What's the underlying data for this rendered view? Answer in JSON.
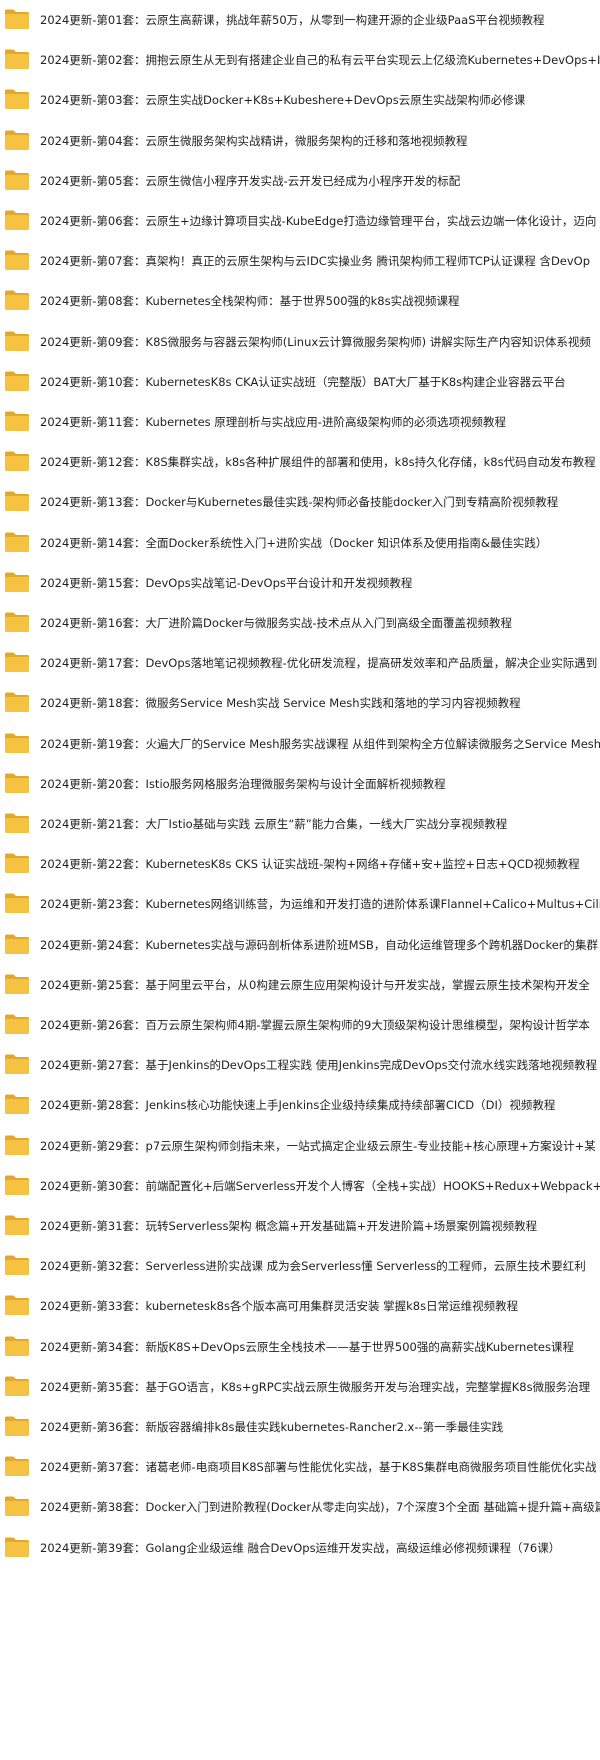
{
  "folder_icon": "folder-icon",
  "folder_color": "#f5c242",
  "folder_color_dark": "#e0a82e",
  "items": [
    {
      "label": "2024更新-第01套：云原生高薪课，挑战年薪50万，从零到一构建开源的企业级PaaS平台视频教程"
    },
    {
      "label": "2024更新-第02套：拥抱云原生从无到有搭建企业自己的私有云平台实现云上亿级流Kubernetes+DevOps+I"
    },
    {
      "label": "2024更新-第03套：云原生实战Docker+K8s+Kubeshere+DevOps云原生实战架构师必修课"
    },
    {
      "label": "2024更新-第04套：云原生微服务架构实战精讲，微服务架构的迁移和落地视频教程"
    },
    {
      "label": "2024更新-第05套：云原生微信小程序开发实战-云开发已经成为小程序开发的标配"
    },
    {
      "label": "2024更新-第06套：云原生+边缘计算项目实战-KubeEdge打造边缘管理平台，实战云边端一体化设计，迈向"
    },
    {
      "label": "2024更新-第07套：真架构！真正的云原生架构与云IDC实操业务 腾讯架构师工程师TCP认证课程 含DevOp"
    },
    {
      "label": "2024更新-第08套：Kubernetes全栈架构师：基于世界500强的k8s实战视频课程"
    },
    {
      "label": "2024更新-第09套：K8S微服务与容器云架构师(Linux云计算微服务架构师) 讲解实际生产内容知识体系视频"
    },
    {
      "label": "2024更新-第10套：KubernetesK8s CKA认证实战班（完整版）BAT大厂基于K8s构建企业容器云平台"
    },
    {
      "label": "2024更新-第11套：Kubernetes 原理剖析与实战应用-进阶高级架构师的必须选项视频教程"
    },
    {
      "label": "2024更新-第12套：K8S集群实战，k8s各种扩展组件的部署和使用，k8s持久化存储，k8s代码自动发布教程"
    },
    {
      "label": "2024更新-第13套：Docker与Kubernetes最佳实践-架构师必备技能docker入门到专精高阶视频教程"
    },
    {
      "label": "2024更新-第14套：全面Docker系统性入门+进阶实战（Docker 知识体系及使用指南&最佳实践）"
    },
    {
      "label": "2024更新-第15套：DevOps实战笔记-DevOps平台设计和开发视频教程"
    },
    {
      "label": "2024更新-第16套：大厂进阶篇Docker与微服务实战-技术点从入门到高级全面覆盖视频教程"
    },
    {
      "label": "2024更新-第17套：DevOps落地笔记视频教程-优化研发流程，提高研发效率和产品质量，解决企业实际遇到"
    },
    {
      "label": "2024更新-第18套：微服务Service Mesh实战 Service Mesh实践和落地的学习内容视频教程"
    },
    {
      "label": "2024更新-第19套：火遍大厂的Service Mesh服务实战课程 从组件到架构全方位解读微服务之Service Mesh"
    },
    {
      "label": "2024更新-第20套：Istio服务网格服务治理微服务架构与设计全面解析视频教程"
    },
    {
      "label": "2024更新-第21套：大厂Istio基础与实践 云原生“薪”能力合集，一线大厂实战分享视频教程"
    },
    {
      "label": "2024更新-第22套：KubernetesK8s CKS 认证实战班-架构+网络+存储+安+监控+日志+QCD视频教程"
    },
    {
      "label": "2024更新-第23套：Kubernetes网络训练营，为运维和开发打造的进阶体系课Flannel+Calico+Multus+Cilium"
    },
    {
      "label": "2024更新-第24套：Kubernetes实战与源码剖析体系进阶班MSB，自动化运维管理多个跨机器Docker的集群"
    },
    {
      "label": "2024更新-第25套：基于阿里云平台，从0构建云原生应用架构设计与开发实战，掌握云原生技术架构开发全"
    },
    {
      "label": "2024更新-第26套：百万云原生架构师4期-掌握云原生架构师的9大顶级架构设计思维模型，架构设计哲学本"
    },
    {
      "label": "2024更新-第27套：基于Jenkins的DevOps工程实践 使用Jenkins完成DevOps交付流水线实践落地视频教程"
    },
    {
      "label": "2024更新-第28套：Jenkins核心功能快速上手Jenkins企业级持续集成持续部署CICD（DI）视频教程"
    },
    {
      "label": "2024更新-第29套：p7云原生架构师剑指未来，一站式搞定企业级云原生-专业技能+核心原理+方案设计+某"
    },
    {
      "label": "2024更新-第30套：前端配置化+后端Serverless开发个人博客（全栈+实战）HOOKS+Redux+Webpack+Im"
    },
    {
      "label": "2024更新-第31套：玩转Serverless架构 概念篇+开发基础篇+开发进阶篇+场景案例篇视频教程"
    },
    {
      "label": "2024更新-第32套：Serverless进阶实战课 成为会Serverless懂 Serverless的工程师，云原生技术要红利"
    },
    {
      "label": "2024更新-第33套：kubernetesk8s各个版本高可用集群灵活安装 掌握k8s日常运维视频教程"
    },
    {
      "label": "2024更新-第34套：新版K8S+DevOps云原生全栈技术——基于世界500强的高薪实战Kubernetes课程"
    },
    {
      "label": "2024更新-第35套：基于GO语言，K8s+gRPC实战云原生微服务开发与治理实战，完整掌握K8s微服务治理"
    },
    {
      "label": "2024更新-第36套：新版容器编排k8s最佳实践kubernetes-Rancher2.x--第一季最佳实践"
    },
    {
      "label": "2024更新-第37套：诸葛老师-电商项目K8S部署与性能优化实战，基于K8S集群电商微服务项目性能优化实战"
    },
    {
      "label": "2024更新-第38套：Docker入门到进阶教程(Docker从零走向实战)，7个深度3个全面 基础篇+提升篇+高级篇"
    },
    {
      "label": "2024更新-第39套：Golang企业级运维 融合DevOps运维开发实战，高级运维必修视频课程（76课）"
    }
  ]
}
